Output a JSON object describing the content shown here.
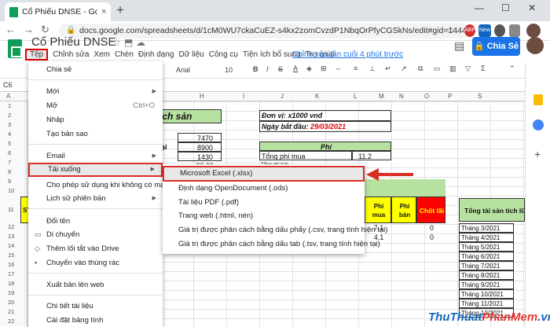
{
  "browser": {
    "tab_title": "Cổ Phiếu DNSE - Google Trang tính",
    "tab_close": "×",
    "new_tab": "+",
    "min": "—",
    "max": "☐",
    "close": "✕",
    "url": "docs.google.com/spreadsheets/d/1cM0WU7ckaCuEZ-s4kx2zomCvzdP1NbqOrPfyCGSkNs/edit#gid=1444574781",
    "ext_badge": "New",
    "ext_icon_label": "ABP"
  },
  "doc": {
    "title": "Cổ Phiếu DNSE",
    "share_label": "Chia Sẻ",
    "last_edit": "Chỉnh sửa lần cuối 4 phút trước"
  },
  "menubar": [
    "Tệp",
    "Chỉnh sửa",
    "Xem",
    "Chèn",
    "Định dạng",
    "Dữ liệu",
    "Công cụ",
    "Tiện ích bổ sung",
    "Trợ giúp"
  ],
  "toolbar": {
    "font": "Arial",
    "size": "10"
  },
  "namebox": "C6",
  "col_headers": [
    "A",
    "B",
    "C",
    "D",
    "E",
    "F",
    "G",
    "H",
    "I",
    "J",
    "K",
    "L",
    "M",
    "N",
    "O",
    "P",
    "Q",
    "R",
    "S"
  ],
  "row_numbers": [
    "1",
    "2",
    "3",
    "4",
    "5",
    "6",
    "7",
    "8",
    "9",
    "10",
    "11",
    "12",
    "13",
    "14",
    "15",
    "16",
    "17",
    "18",
    "19",
    "20",
    "21",
    "22",
    "23"
  ],
  "file_menu": [
    {
      "label": "Chia sẻ"
    },
    {
      "label": "Mới",
      "arrow": "▶"
    },
    {
      "label": "Mở",
      "shortcut": "Ctrl+O"
    },
    {
      "label": "Nhập"
    },
    {
      "label": "Tạo bản sao"
    },
    {
      "label": "Email",
      "arrow": "▶"
    },
    {
      "label": "Tải xuống",
      "arrow": "▶"
    },
    {
      "label": "Cho phép sử dụng khi không có mạng"
    },
    {
      "label": "Lịch sử phiên bản",
      "arrow": "▶"
    },
    {
      "label": "Đổi tên"
    },
    {
      "label": "Di chuyển"
    },
    {
      "label": "Thêm lối tắt vào Drive"
    },
    {
      "label": "Chuyển vào thùng rác"
    },
    {
      "label": "Xuất bản lên web"
    },
    {
      "label": "Chi tiết tài liệu"
    },
    {
      "label": "Cài đặt bảng tính"
    }
  ],
  "download_menu": [
    "Microsoft Excel (.xlsx)",
    "Định dạng OpenDocument (.ods)",
    "Tài liệu PDF (.pdf)",
    "Trang web (.html, nén)",
    "Giá trị được phân cách bằng dấu phẩy (.csv, trang tính hiện tại)",
    "Giá trị được phân cách bằng dấu tab (.tsv, trang tính hiện tại)"
  ],
  "sheet": {
    "title_fragment": "ích sản",
    "label_tai": "tại",
    "values_col": [
      "7470",
      "8900",
      "1430",
      "32,29"
    ],
    "don_vi": "Đơn vị: x1000 vnđ",
    "ngay_label": "Ngày bắt đầu:",
    "ngay_value": "29/03/2021",
    "phi_header": "Phí",
    "tong_phi_label": "Tổng phí mua",
    "tong_phi_value": "11.2",
    "row10_label": "Tổng phí bán",
    "st_label": "ST",
    "phi_mua": "Phí mua",
    "phi_ban": "Phí bán",
    "chot_lai": "Chốt lãi",
    "phi_mua_vals": [
      "7.1",
      "4.1"
    ],
    "chot_vals": [
      "0",
      "0"
    ],
    "tong_tai_san": "Tổng tài sản tích lũy",
    "months": [
      "Tháng 3/2021",
      "Tháng 4/2021",
      "Tháng 5/2021",
      "Tháng 6/2021",
      "Tháng 7/2021",
      "Tháng 8/2021",
      "Tháng 9/2021",
      "Tháng 10/2021",
      "Tháng 11/2021",
      "Tháng 12/2021"
    ]
  },
  "watermark": {
    "part1": "ThuThuat",
    "part2": "PhanMem",
    ".vn": ".vn"
  },
  "colors": {
    "accent": "#1a73e8",
    "highlight": "#d93025",
    "sheet_green": "#b7e1a1"
  }
}
